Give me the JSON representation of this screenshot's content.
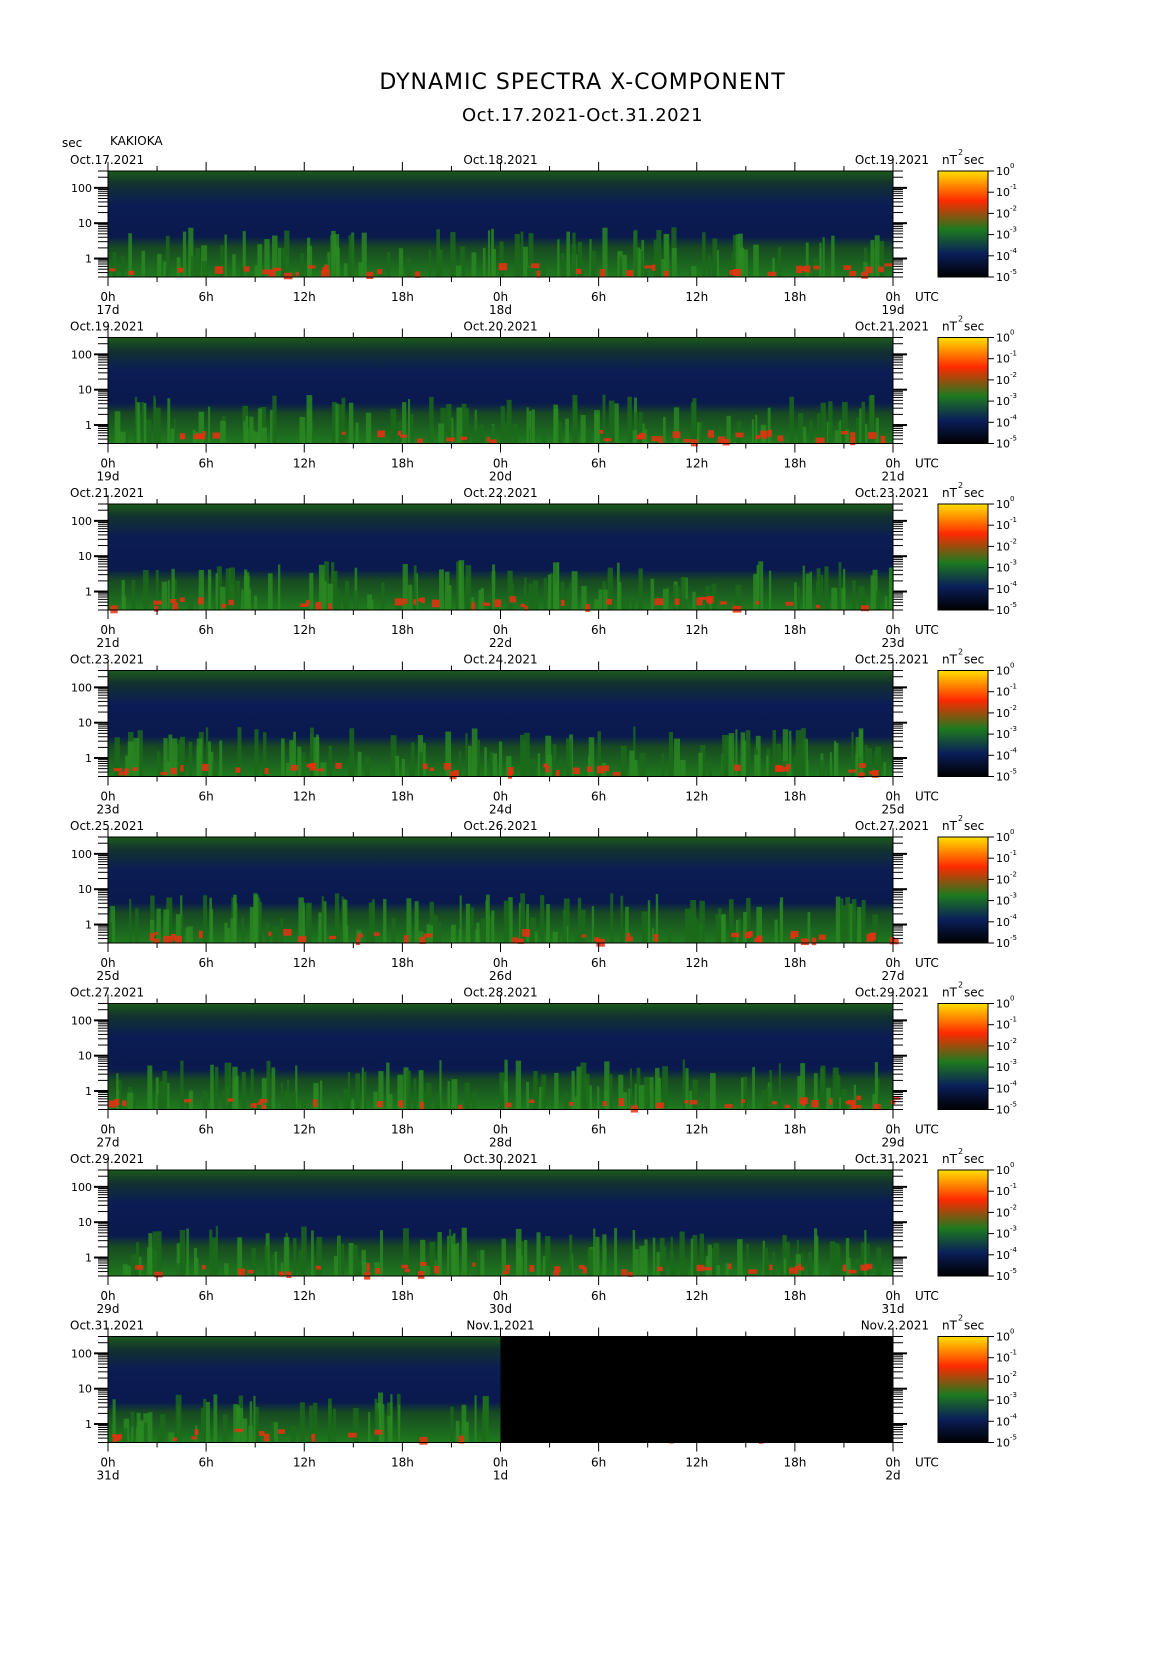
{
  "title": "DYNAMIC SPECTRA X-COMPONENT",
  "subtitle": "Oct.17.2021-Oct.31.2021",
  "y_unit": "sec",
  "station": "KAKIOKA",
  "x_unit": "UTC",
  "colorbar_unit_base": "nT",
  "colorbar_unit_exp": "2",
  "colorbar_unit_suffix": "sec",
  "y_tick_labels": [
    "1",
    "10",
    "100"
  ],
  "x_tick_labels": [
    "0h",
    "6h",
    "12h",
    "18h",
    "0h",
    "6h",
    "12h",
    "18h",
    "0h"
  ],
  "colorbar_tick_base": "10",
  "colorbar_tick_exponents": [
    "0",
    "-1",
    "-2",
    "-3",
    "-4",
    "-5"
  ],
  "colors": {
    "colormap": [
      "#000000",
      "#0a1f5a",
      "#1e7a1e",
      "#ff2a00",
      "#ffe000"
    ],
    "missing_data": "#000000"
  },
  "chart_data": {
    "type": "heatmap",
    "description": "Dynamic spectra (period vs time) of the X component of the geomagnetic field",
    "y_axis": {
      "label": "sec",
      "scale": "log",
      "range_sec": [
        300,
        0.3
      ]
    },
    "x_axis": {
      "label": "UTC",
      "range_hours_per_panel": 48
    },
    "colorbar": {
      "unit": "nT^2 sec",
      "scale": "log",
      "range": [
        1e-05,
        1
      ]
    },
    "panels": [
      {
        "start_label": "Oct.17.2021",
        "mid_label": "Oct.18.2021",
        "end_label": "Oct.19.2021",
        "day_labels": [
          "17d",
          "18d",
          "19d"
        ],
        "missing_after_hours": null
      },
      {
        "start_label": "Oct.19.2021",
        "mid_label": "Oct.20.2021",
        "end_label": "Oct.21.2021",
        "day_labels": [
          "19d",
          "20d",
          "21d"
        ],
        "missing_after_hours": null
      },
      {
        "start_label": "Oct.21.2021",
        "mid_label": "Oct.22.2021",
        "end_label": "Oct.23.2021",
        "day_labels": [
          "21d",
          "22d",
          "23d"
        ],
        "missing_after_hours": null
      },
      {
        "start_label": "Oct.23.2021",
        "mid_label": "Oct.24.2021",
        "end_label": "Oct.25.2021",
        "day_labels": [
          "23d",
          "24d",
          "25d"
        ],
        "missing_after_hours": null
      },
      {
        "start_label": "Oct.25.2021",
        "mid_label": "Oct.26.2021",
        "end_label": "Oct.27.2021",
        "day_labels": [
          "25d",
          "26d",
          "27d"
        ],
        "missing_after_hours": null
      },
      {
        "start_label": "Oct.27.2021",
        "mid_label": "Oct.28.2021",
        "end_label": "Oct.29.2021",
        "day_labels": [
          "27d",
          "28d",
          "29d"
        ],
        "missing_after_hours": null
      },
      {
        "start_label": "Oct.29.2021",
        "mid_label": "Oct.30.2021",
        "end_label": "Oct.31.2021",
        "day_labels": [
          "29d",
          "30d",
          "31d"
        ],
        "missing_after_hours": null
      },
      {
        "start_label": "Oct.31.2021",
        "mid_label": "Nov.1.2021",
        "end_label": "Nov.2.2021",
        "day_labels": [
          "31d",
          "1d",
          "2d"
        ],
        "missing_after_hours": 24
      }
    ],
    "spikes": [
      {
        "panel": 0,
        "hour": 0.2,
        "top_sec": 0.4,
        "peak": "red"
      },
      {
        "panel": 0,
        "hour": 6.6,
        "top_sec": 0.4,
        "peak": "red"
      },
      {
        "panel": 0,
        "hour": 45.5,
        "top_sec": 0.4,
        "peak": "yellow"
      },
      {
        "panel": 1,
        "hour": 15.6,
        "top_sec": 0.4,
        "peak": "yellow"
      },
      {
        "panel": 1,
        "hour": 17.5,
        "top_sec": 8,
        "peak": "red"
      },
      {
        "panel": 3,
        "hour": 24.5,
        "top_sec": 0.4,
        "peak": "red"
      },
      {
        "panel": 4,
        "hour": 28.2,
        "top_sec": 0.4,
        "peak": "red"
      },
      {
        "panel": 5,
        "hour": 6.0,
        "top_sec": 0.4,
        "peak": "yellow"
      },
      {
        "panel": 5,
        "hour": 14.3,
        "top_sec": 0.4,
        "peak": "yellow"
      },
      {
        "panel": 5,
        "hour": 31.9,
        "top_sec": 0.4,
        "peak": "yellow"
      },
      {
        "panel": 5,
        "hour": 0.6,
        "top_sec": 0.6,
        "peak": "red"
      },
      {
        "panel": 7,
        "hour": 21.3,
        "top_sec": 0.5,
        "peak": "red"
      }
    ]
  }
}
